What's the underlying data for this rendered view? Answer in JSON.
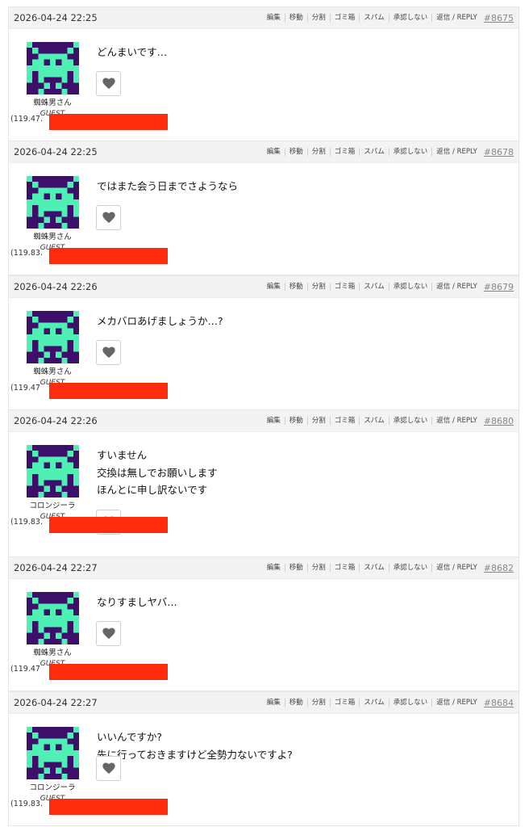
{
  "actions": [
    "編集",
    "移動",
    "分割",
    "ゴミ箱",
    "スパム",
    "承認しない",
    "返信 / REPLY"
  ],
  "colors": {
    "avatar_bg": "#3d0f6b",
    "avatar_fg": "#4ef0b4",
    "redaction": "#ff2b0d",
    "header_bg": "#f3f3f3"
  },
  "like_icon": "heart-icon",
  "posts": [
    {
      "date": "2026-04-24 22:25",
      "id": "#8675",
      "author": "蜘蛛男さん",
      "role": "GUEST",
      "ip": "(119.47.",
      "message": [
        "どんまいです…"
      ]
    },
    {
      "date": "2026-04-24 22:25",
      "id": "#8678",
      "author": "蜘蛛男さん",
      "role": "GUEST",
      "ip": "(119.83.",
      "message": [
        "ではまた会う日までさようなら"
      ]
    },
    {
      "date": "2026-04-24 22:26",
      "id": "#8679",
      "author": "蜘蛛男さん",
      "role": "GUEST",
      "ip": "(119.47",
      "message": [
        "メカバロあげましょうか…?"
      ]
    },
    {
      "date": "2026-04-24 22:26",
      "id": "#8680",
      "author": "コロンジーラ",
      "role": "GUEST",
      "ip": "(119.83.",
      "message": [
        "すいません",
        "交換は無しでお願いします",
        "ほんとに申し訳ないです"
      ]
    },
    {
      "date": "2026-04-24 22:27",
      "id": "#8682",
      "author": "蜘蛛男さん",
      "role": "GUEST",
      "ip": "(119.47",
      "message": [
        "なりすましヤバ…"
      ]
    },
    {
      "date": "2026-04-24 22:27",
      "id": "#8684",
      "author": "コロンジーラ",
      "role": "GUEST",
      "ip": "(119.83.",
      "message": [
        "いいんですか?",
        "先に行っておきますけど全勢力ないですよ?"
      ]
    }
  ]
}
